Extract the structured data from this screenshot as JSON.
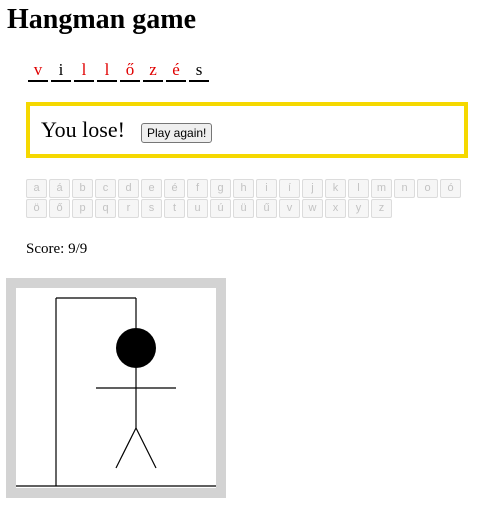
{
  "title": "Hangman game",
  "word": [
    {
      "letter": "v",
      "missed": true
    },
    {
      "letter": "i",
      "missed": false
    },
    {
      "letter": "l",
      "missed": true
    },
    {
      "letter": "l",
      "missed": true
    },
    {
      "letter": "ő",
      "missed": true
    },
    {
      "letter": "z",
      "missed": true
    },
    {
      "letter": "é",
      "missed": true
    },
    {
      "letter": "s",
      "missed": false
    }
  ],
  "result": {
    "message": "You lose!",
    "play_again_label": "Play again!"
  },
  "keyboard": [
    "a",
    "á",
    "b",
    "c",
    "d",
    "e",
    "é",
    "f",
    "g",
    "h",
    "i",
    "í",
    "j",
    "k",
    "l",
    "m",
    "n",
    "o",
    "ó",
    "ö",
    "ő",
    "p",
    "q",
    "r",
    "s",
    "t",
    "u",
    "ú",
    "ü",
    "ű",
    "v",
    "w",
    "x",
    "y",
    "z"
  ],
  "score": "Score: 9/9",
  "colors": {
    "missed_letter": "#e00000",
    "result_border": "#f5d800",
    "frame": "#d3d3d3"
  }
}
